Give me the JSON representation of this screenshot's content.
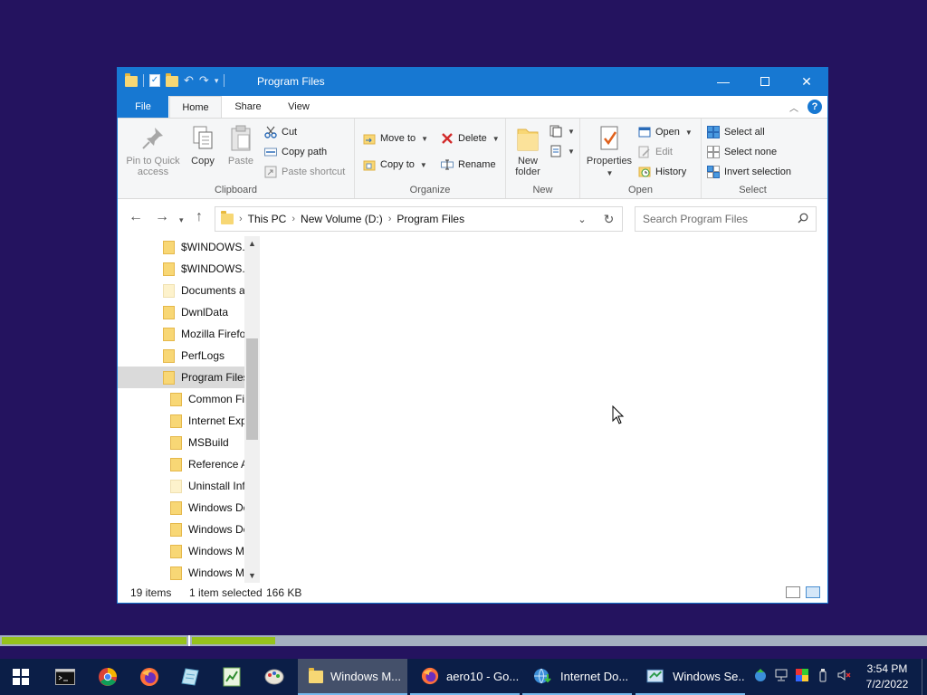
{
  "window": {
    "title": "Program Files",
    "controls": {
      "minimize": "—",
      "maximize": "",
      "close": "✕"
    }
  },
  "ribbon_tabs": [
    "File",
    "Home",
    "Share",
    "View"
  ],
  "ribbon": {
    "clipboard": {
      "label": "Clipboard",
      "pin_line1": "Pin to Quick",
      "pin_line2": "access",
      "copy": "Copy",
      "paste": "Paste",
      "cut": "Cut",
      "copy_path": "Copy path",
      "paste_shortcut": "Paste shortcut"
    },
    "organize": {
      "label": "Organize",
      "move_to": "Move to",
      "copy_to": "Copy to",
      "delete": "Delete",
      "rename": "Rename"
    },
    "new": {
      "label": "New",
      "new_folder_line1": "New",
      "new_folder_line2": "folder"
    },
    "open": {
      "label": "Open",
      "properties": "Properties",
      "open": "Open",
      "edit": "Edit",
      "history": "History"
    },
    "select": {
      "label": "Select",
      "select_all": "Select all",
      "select_none": "Select none",
      "invert": "Invert selection"
    }
  },
  "address": {
    "crumbs": [
      "This PC",
      "New Volume (D:)",
      "Program Files"
    ],
    "search_placeholder": "Search Program Files"
  },
  "nav_tree": [
    {
      "label": "$WINDOWS.~",
      "indent": 0,
      "light": false
    },
    {
      "label": "$WINDOWS.~",
      "indent": 0,
      "light": false
    },
    {
      "label": "Documents a",
      "indent": 0,
      "light": true
    },
    {
      "label": "DwnlData",
      "indent": 0,
      "light": false
    },
    {
      "label": "Mozilla Firefo",
      "indent": 0,
      "light": false
    },
    {
      "label": "PerfLogs",
      "indent": 0,
      "light": false
    },
    {
      "label": "Program Files",
      "indent": 0,
      "light": false,
      "selected": true
    },
    {
      "label": "Common Fi",
      "indent": 1,
      "light": false
    },
    {
      "label": "Internet Exp",
      "indent": 1,
      "light": false
    },
    {
      "label": "MSBuild",
      "indent": 1,
      "light": false
    },
    {
      "label": "Reference A",
      "indent": 1,
      "light": false
    },
    {
      "label": "Uninstall Inf",
      "indent": 1,
      "light": true
    },
    {
      "label": "Windows De",
      "indent": 1,
      "light": false
    },
    {
      "label": "Windows De",
      "indent": 1,
      "light": false
    },
    {
      "label": "Windows M",
      "indent": 1,
      "light": false
    },
    {
      "label": "Windows M",
      "indent": 1,
      "light": false
    }
  ],
  "status": {
    "items": "19 items",
    "selected": "1 item selected",
    "size": "166 KB"
  },
  "progress": {
    "bar1_fraction": 0.2,
    "bar2_fraction": 0.09
  },
  "taskbar": {
    "tasks": [
      {
        "label": "Windows M...",
        "icon": "folder-icon",
        "active": true
      },
      {
        "label": "aero10 - Go...",
        "icon": "firefox-icon",
        "active": false
      },
      {
        "label": "Internet Do...",
        "icon": "internet-download-icon",
        "active": false
      },
      {
        "label": "Windows Se...",
        "icon": "windows-settings-icon",
        "active": false
      }
    ],
    "time": "3:54 PM",
    "date": "7/2/2022"
  },
  "colors": {
    "desktop": "#24135f",
    "accent": "#1778d2",
    "taskbar": "#0b1e47",
    "progress": "#96c21d"
  }
}
